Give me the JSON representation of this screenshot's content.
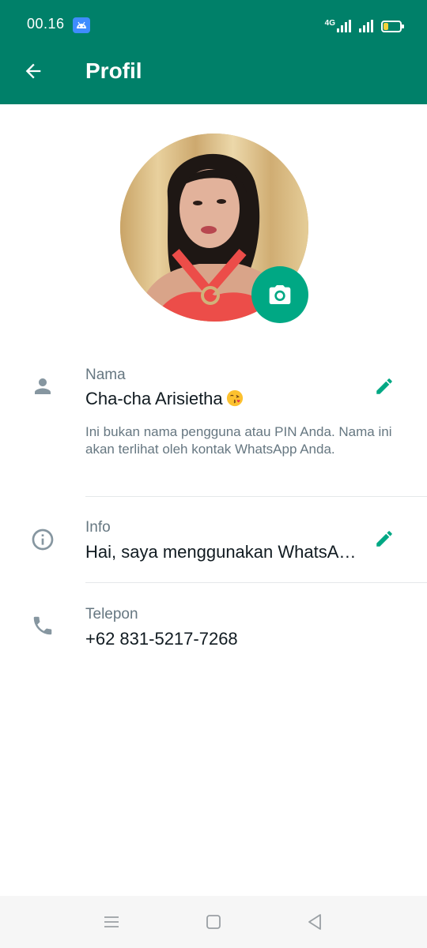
{
  "status_bar": {
    "time": "00.16",
    "network": "4G"
  },
  "battery": {
    "level_fraction": 0.3
  },
  "header": {
    "title": "Profil"
  },
  "profile": {
    "name_label": "Nama",
    "name_value": "Cha-cha Arisietha",
    "name_emoji": "😘",
    "name_hint": "Ini bukan nama pengguna atau PIN Anda. Nama ini akan terlihat oleh kontak WhatsApp Anda.",
    "info_label": "Info",
    "info_value": "Hai, saya menggunakan WhatsA…",
    "phone_label": "Telepon",
    "phone_value": "+62 831-5217-7268"
  },
  "colors": {
    "header": "#008069",
    "accent": "#00a884",
    "secondary_text": "#667781"
  },
  "icons": {
    "back": "arrow-left-icon",
    "camera": "camera-icon",
    "person": "person-icon",
    "info": "info-icon",
    "phone": "phone-icon",
    "edit": "pencil-icon"
  }
}
